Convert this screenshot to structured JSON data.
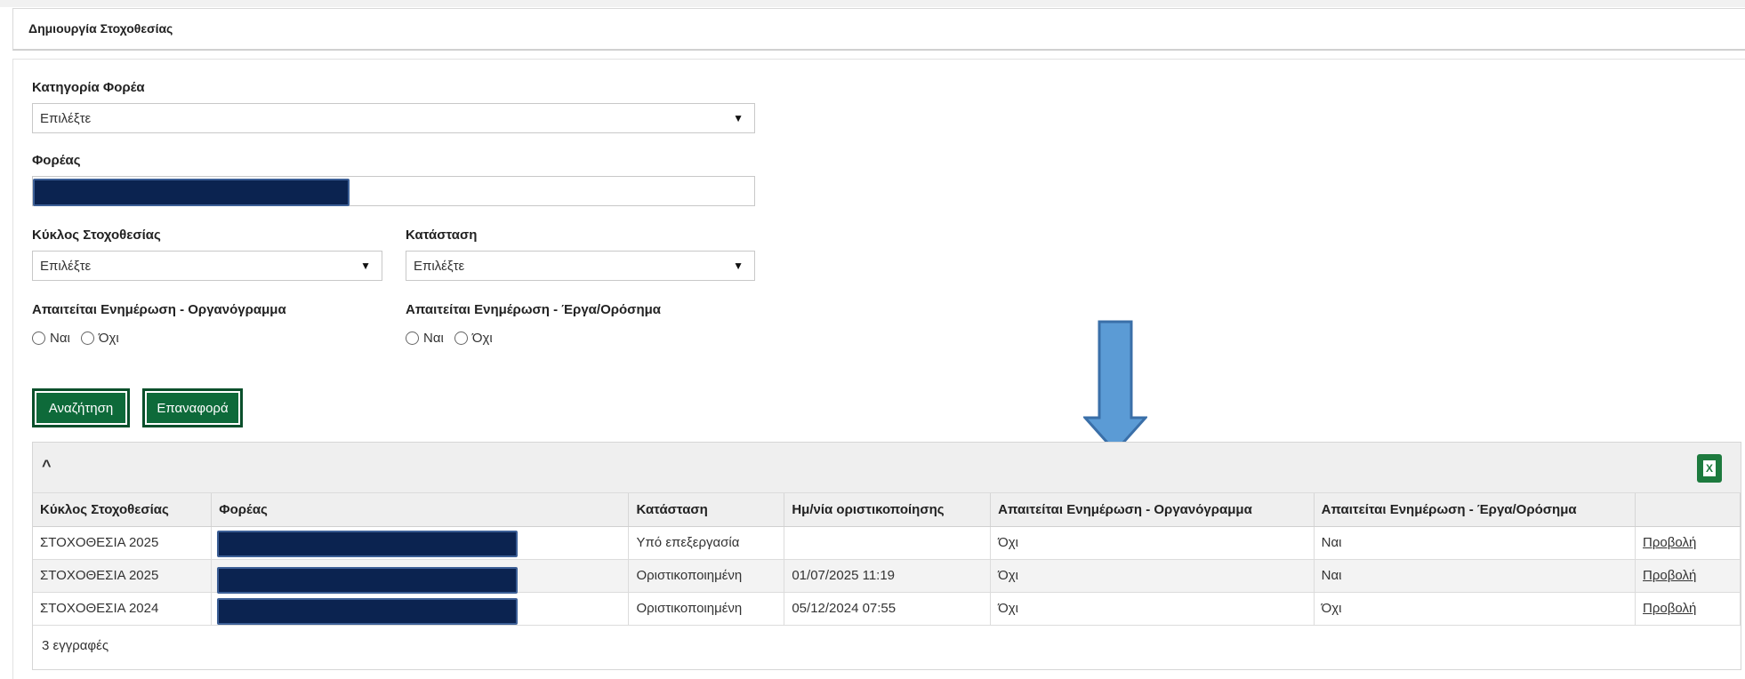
{
  "header": {
    "title": "Δημιουργία Στοχοθεσίας"
  },
  "form": {
    "category": {
      "label": "Κατηγορία Φορέα",
      "value": "Επιλέξτε"
    },
    "entity": {
      "label": "Φορέας"
    },
    "cycle": {
      "label": "Κύκλος Στοχοθεσίας",
      "value": "Επιλέξτε"
    },
    "status": {
      "label": "Κατάσταση",
      "value": "Επιλέξτε"
    },
    "org_update": {
      "label": "Απαιτείται Ενημέρωση - Οργανόγραμμα",
      "yes": "Ναι",
      "no": "Όχι"
    },
    "works_update": {
      "label": "Απαιτείται Ενημέρωση - Έργα/Ορόσημα",
      "yes": "Ναι",
      "no": "Όχι"
    }
  },
  "buttons": {
    "search": "Αναζήτηση",
    "reset": "Επαναφορά"
  },
  "results": {
    "collapse_symbol": "^",
    "excel_symbol": "X",
    "columns": [
      "Κύκλος Στοχοθεσίας",
      "Φορέας",
      "Κατάσταση",
      "Ημ/νία οριστικοποίησης",
      "Απαιτείται Ενημέρωση - Οργανόγραμμα",
      "Απαιτείται Ενημέρωση - Έργα/Ορόσημα",
      ""
    ],
    "rows": [
      {
        "cycle": "ΣΤΟΧΟΘΕΣΙΑ 2025",
        "status": "Υπό επεξεργασία",
        "date": "",
        "org": "Όχι",
        "works": "Ναι",
        "action": "Προβολή"
      },
      {
        "cycle": "ΣΤΟΧΟΘΕΣΙΑ 2025",
        "status": "Οριστικοποιημένη",
        "date": "01/07/2025 11:19",
        "org": "Όχι",
        "works": "Ναι",
        "action": "Προβολή"
      },
      {
        "cycle": "ΣΤΟΧΟΘΕΣΙΑ 2024",
        "status": "Οριστικοποιημένη",
        "date": "05/12/2024 07:55",
        "org": "Όχι",
        "works": "Όχι",
        "action": "Προβολή"
      }
    ],
    "footer": "3 εγγραφές"
  },
  "colors": {
    "primary_button": "#0e6a3a",
    "redaction": "#0b2350",
    "arrow": "#5b9bd5"
  }
}
